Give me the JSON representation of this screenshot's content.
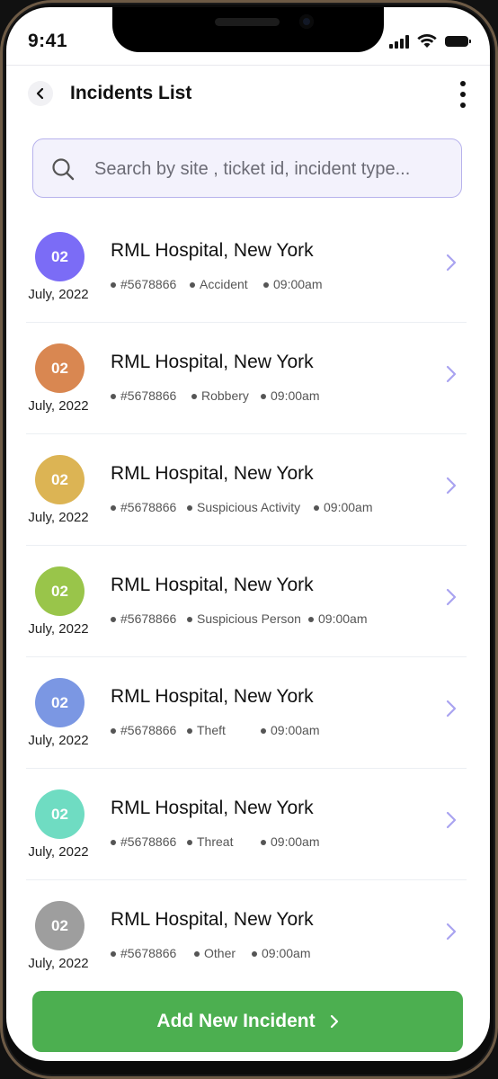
{
  "status_bar": {
    "time": "9:41"
  },
  "header": {
    "title": "Incidents List"
  },
  "search": {
    "placeholder": "Search by site , ticket id, incident type..."
  },
  "incidents": [
    {
      "day": "02",
      "month_year": "July, 2022",
      "site": "RML Hospital, New York",
      "ticket": "#5678866",
      "type": "Accident",
      "time": "09:00am",
      "color": "#7b6cf6"
    },
    {
      "day": "02",
      "month_year": "July, 2022",
      "site": "RML Hospital, New York",
      "ticket": "#5678866",
      "type": "Robbery",
      "time": "09:00am",
      "color": "#d98751"
    },
    {
      "day": "02",
      "month_year": "July, 2022",
      "site": "RML Hospital, New York",
      "ticket": "#5678866",
      "type": "Suspicious Activity",
      "time": "09:00am",
      "color": "#dcb454"
    },
    {
      "day": "02",
      "month_year": "July, 2022",
      "site": "RML Hospital, New York",
      "ticket": "#5678866",
      "type": "Suspicious Person",
      "time": "09:00am",
      "color": "#99c54a"
    },
    {
      "day": "02",
      "month_year": "July, 2022",
      "site": "RML Hospital, New York",
      "ticket": "#5678866",
      "type": "Theft",
      "time": "09:00am",
      "color": "#7b97e3"
    },
    {
      "day": "02",
      "month_year": "July, 2022",
      "site": "RML Hospital, New York",
      "ticket": "#5678866",
      "type": "Threat",
      "time": "09:00am",
      "color": "#6fdcc2"
    },
    {
      "day": "02",
      "month_year": "July, 2022",
      "site": "RML Hospital, New York",
      "ticket": "#5678866",
      "type": "Other",
      "time": "09:00am",
      "color": "#9e9e9e"
    }
  ],
  "footer": {
    "add_button_label": "Add New Incident"
  },
  "colors": {
    "primary": "#4caf50",
    "chevron": "#a9a3f0",
    "search_border": "#b7b2ec"
  }
}
